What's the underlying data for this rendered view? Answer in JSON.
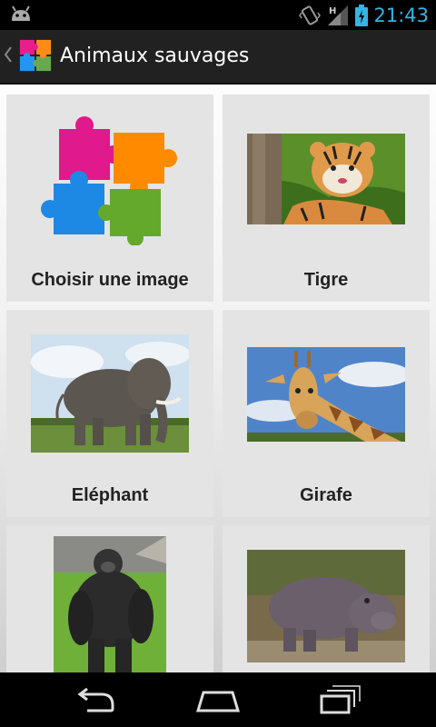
{
  "status_bar": {
    "time": "21:43",
    "network_type": "H",
    "icons": [
      "android-icon",
      "vibrate-icon",
      "signal-icon",
      "battery-icon"
    ],
    "accent_color": "#33b5e5"
  },
  "action_bar": {
    "title": "Animaux sauvages",
    "icons": [
      "up-caret-icon",
      "puzzle-logo-icon"
    ]
  },
  "grid": {
    "items": [
      {
        "label": "Choisir une image",
        "image": "puzzle-image"
      },
      {
        "label": "Tigre",
        "image": "tiger-photo"
      },
      {
        "label": "Eléphant",
        "image": "elephant-photo"
      },
      {
        "label": "Girafe",
        "image": "giraffe-photo"
      },
      {
        "label": "",
        "image": "gorilla-photo"
      },
      {
        "label": "",
        "image": "hippo-photo"
      }
    ]
  },
  "nav_bar": {
    "buttons": [
      "back-icon",
      "home-icon",
      "recent-apps-icon"
    ]
  }
}
